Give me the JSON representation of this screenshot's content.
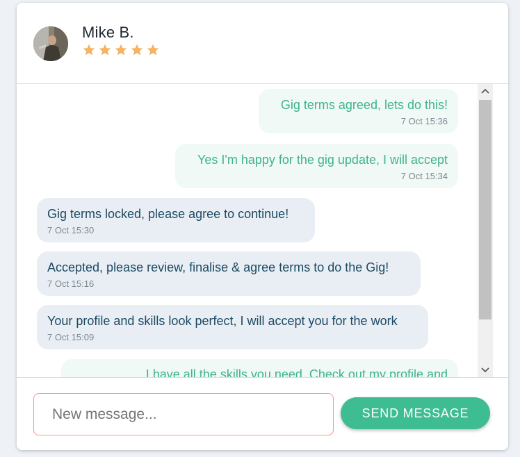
{
  "header": {
    "name": "Mike B.",
    "rating": 5,
    "rating_max": 5,
    "star_color": "#f5b461"
  },
  "messages": [
    {
      "direction": "out",
      "text": "Gig terms agreed, lets do this!",
      "time": "7 Oct 15:36"
    },
    {
      "direction": "out",
      "text": "Yes I'm happy for the gig update, I will accept",
      "time": "7 Oct 15:34"
    },
    {
      "direction": "in",
      "text": "Gig terms locked, please agree to continue!",
      "time": "7 Oct 15:30"
    },
    {
      "direction": "in",
      "text": "Accepted, please review, finalise & agree terms to do the Gig!",
      "time": "7 Oct 15:16"
    },
    {
      "direction": "in",
      "text": "Your profile and skills look perfect, I will accept you for the work",
      "time": "7 Oct 15:09"
    },
    {
      "direction": "out",
      "text": "I have all the skills you need. Check out my profile and",
      "time": ""
    }
  ],
  "composer": {
    "placeholder": "New message...",
    "send_label": "SEND MESSAGE",
    "input_border_color": "#ef9a86",
    "send_color": "#3ebd93"
  },
  "colors": {
    "outgoing_bubble": "#f0f9f5",
    "outgoing_text": "#3eb489",
    "incoming_bubble": "#e9eef4",
    "incoming_text": "#1c4a63"
  }
}
